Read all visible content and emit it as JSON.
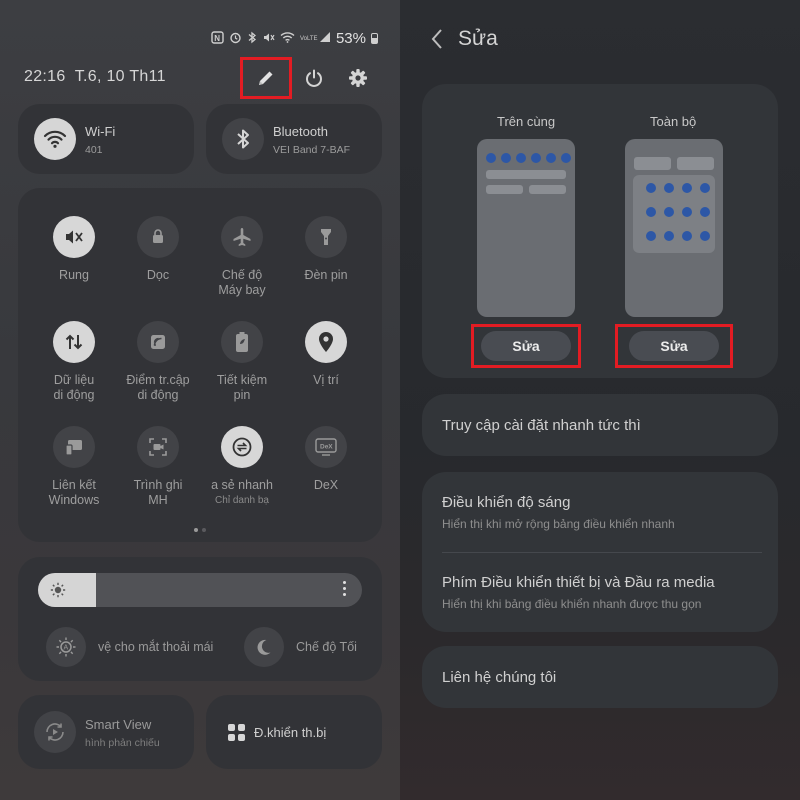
{
  "left": {
    "status": {
      "network": "VoLTE",
      "battery": "53%"
    },
    "datetime": "22:16  T.6, 10 Th11",
    "wifi": {
      "label": "Wi-Fi",
      "sub": "401"
    },
    "bluetooth": {
      "label": "Bluetooth",
      "sub": "VEI Band 7-BAF"
    },
    "tiles": [
      {
        "l1": "Rung",
        "l2": ""
      },
      {
        "l1": "Dọc",
        "l2": ""
      },
      {
        "l1": "Chế độ",
        "l2": "Máy bay"
      },
      {
        "l1": "Đèn pin",
        "l2": ""
      },
      {
        "l1": "Dữ liệu",
        "l2": "di động"
      },
      {
        "l1": "Điểm tr.cập",
        "l2": "di động"
      },
      {
        "l1": "Tiết kiệm",
        "l2": "pin"
      },
      {
        "l1": "Vị trí",
        "l2": ""
      },
      {
        "l1": "Liên kết",
        "l2": "Windows"
      },
      {
        "l1": "Trình ghi",
        "l2": "MH"
      },
      {
        "l1": "a sẻ nhanh",
        "l2": "Chỉ danh bạ"
      },
      {
        "l1": "DeX",
        "l2": ""
      }
    ],
    "eye_comfort": "vệ cho mắt thoải mái",
    "dark_mode": "Chế độ Tối",
    "smart_view": {
      "label": "Smart View",
      "sub": "hình phản chiếu"
    },
    "device_control": "Đ.khiển th.bị",
    "brightness_level": 0.18
  },
  "right": {
    "title": "Sửa",
    "top_label": "Trên cùng",
    "all_label": "Toàn bộ",
    "edit_top": "Sửa",
    "edit_all": "Sửa",
    "instant_access": "Truy cập cài đặt nhanh tức thì",
    "brightness": {
      "title": "Điều khiển độ sáng",
      "sub": "Hiển thị khi mở rộng bảng điều khiển nhanh"
    },
    "media": {
      "title": "Phím Điều khiển thiết bị và Đầu ra media",
      "sub": "Hiển thị khi bảng điều khiển nhanh được thu gọn"
    },
    "contact": "Liên hệ chúng tôi"
  },
  "colors": {
    "highlight": "#e31c23",
    "tile_on": "#d7d7d7",
    "preview_dot": "#2d57a6"
  }
}
